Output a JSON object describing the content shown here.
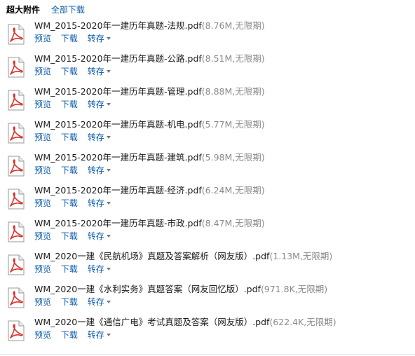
{
  "header": {
    "title": "超大附件",
    "download_all": "全部下载"
  },
  "actions": {
    "preview": "预览",
    "download": "下载",
    "save_to": "转存"
  },
  "files": [
    {
      "name": "WM_2015-2020年一建历年真题-法规.pdf",
      "meta": "(8.76M,无限期)"
    },
    {
      "name": "WM_2015-2020年一建历年真题-公路.pdf",
      "meta": "(8.51M,无限期)"
    },
    {
      "name": "WM_2015-2020年一建历年真题-管理.pdf",
      "meta": "(8.88M,无限期)"
    },
    {
      "name": "WM_2015-2020年一建历年真题-机电.pdf",
      "meta": "(5.77M,无限期)"
    },
    {
      "name": "WM_2015-2020年一建历年真题-建筑.pdf",
      "meta": "(5.98M,无限期)"
    },
    {
      "name": "WM_2015-2020年一建历年真题-经济.pdf",
      "meta": "(6.24M,无限期)"
    },
    {
      "name": "WM_2015-2020年一建历年真题-市政.pdf",
      "meta": "(8.47M,无限期)"
    },
    {
      "name": "WM_2020一建《民航机场》真题及答案解析（网友版）.pdf",
      "meta": "(1.13M,无限期)"
    },
    {
      "name": "WM_2020一建《水利实务》真题答案（网友回忆版）.pdf",
      "meta": "(971.8K,无限期)"
    },
    {
      "name": "WM_2020一建《通信广电》考试真题及答案（网友版）.pdf",
      "meta": "(622.4K,无限期)"
    }
  ],
  "icons": {
    "file": "pdf-file-icon",
    "caret": "caret-down-icon"
  },
  "colors": {
    "link": "#0c5ba8",
    "meta": "#8a8a8a",
    "pdf_red": "#d9322b"
  }
}
